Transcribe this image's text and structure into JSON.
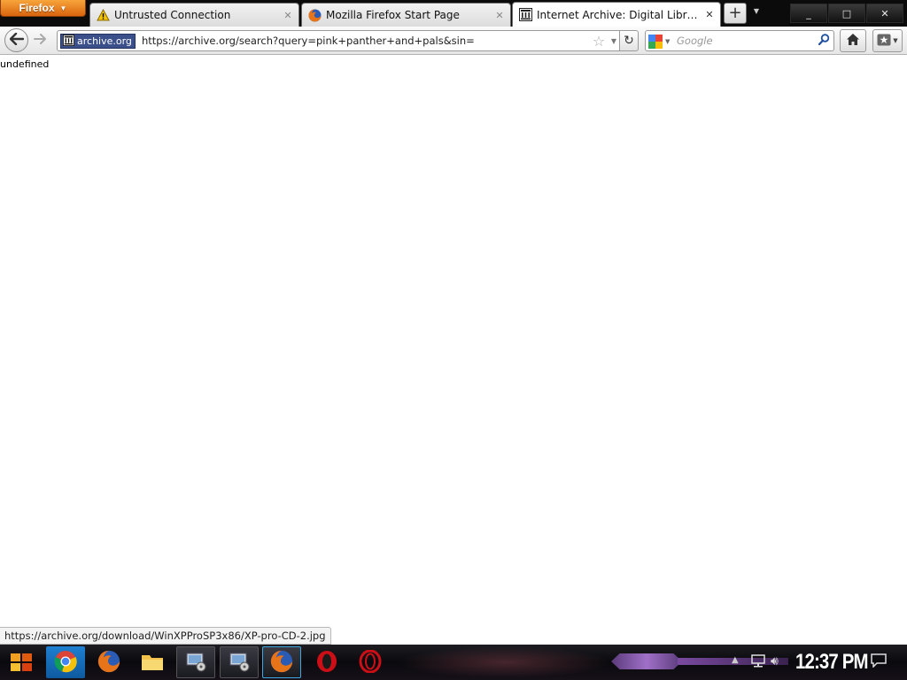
{
  "browser": {
    "app_button_label": "Firefox",
    "tabs": [
      {
        "label": "Untrusted Connection",
        "icon": "warning-icon",
        "active": false
      },
      {
        "label": "Mozilla Firefox Start Page",
        "icon": "firefox-icon",
        "active": false
      },
      {
        "label": "Internet Archive: Digital Library...",
        "icon": "archive-icon",
        "active": true
      }
    ],
    "new_tab_label": "+",
    "window_controls": {
      "minimize": "_",
      "maximize": "□",
      "close": "✕"
    }
  },
  "navbar": {
    "identity_label": "archive.org",
    "url": "https://archive.org/search?query=pink+panther+and+pals&sin=",
    "search_placeholder": "Google"
  },
  "content": {
    "body_text": "undefined"
  },
  "statusbar": {
    "text": "https://archive.org/download/WinXPProSP3x86/XP-pro-CD-2.jpg"
  },
  "taskbar": {
    "clock": "12:37 PM",
    "apps": [
      "start-icon",
      "chrome-icon",
      "firefox-icon",
      "folder-icon",
      "network-drive-icon",
      "network-drive-icon",
      "firefox-icon",
      "opera-icon",
      "opera-icon"
    ]
  },
  "colors": {
    "firefox_button": "#e8801f",
    "identity_badge": "#3b4f8a",
    "taskbar_bg": "#0f0f14"
  }
}
